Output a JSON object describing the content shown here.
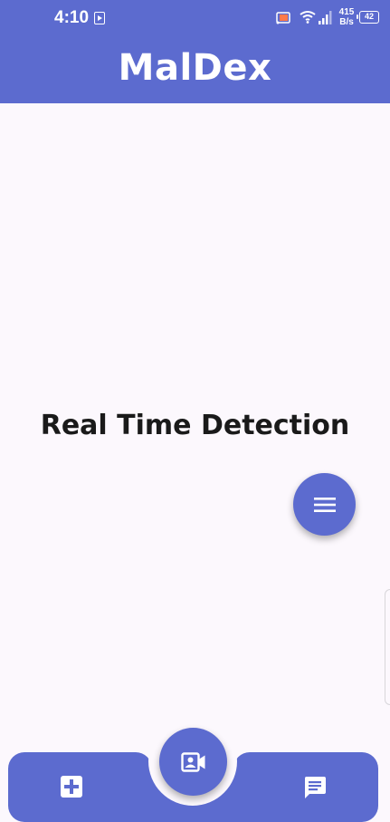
{
  "status_bar": {
    "time": "4:10",
    "network_speed_value": "415",
    "network_speed_unit": "B/s",
    "battery_level": "42",
    "icons": [
      "media-icon",
      "cast-icon",
      "wifi-icon",
      "signal-icon",
      "battery-icon"
    ]
  },
  "app_bar": {
    "title": "MalDex"
  },
  "main": {
    "heading": "Real Time Detection"
  },
  "fab": {
    "icon": "menu-icon"
  },
  "bottom_nav": {
    "left_icon": "add-box-icon",
    "center_icon": "video-contact-icon",
    "right_icon": "chat-icon"
  },
  "colors": {
    "primary": "#5c6bcf",
    "background": "#fcf8fd",
    "text": "#1a1a1a",
    "on_primary": "#ffffff"
  }
}
